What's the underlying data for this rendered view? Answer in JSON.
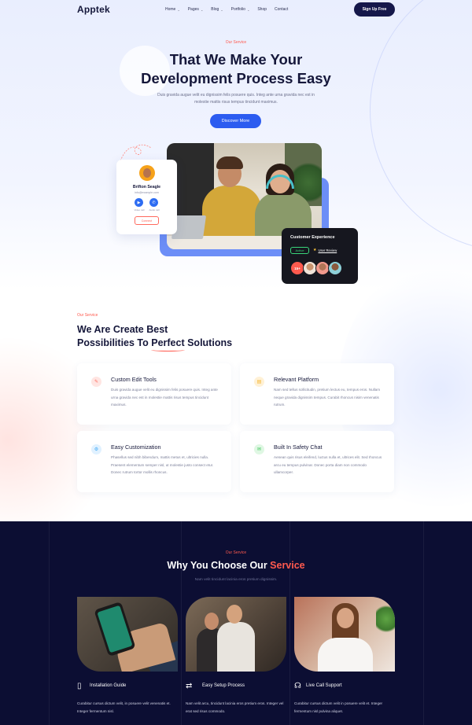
{
  "header": {
    "logo": "Apptek",
    "nav": [
      {
        "label": "Home",
        "dropdown": true
      },
      {
        "label": "Pages",
        "dropdown": true
      },
      {
        "label": "Blog",
        "dropdown": true
      },
      {
        "label": "Portfolio",
        "dropdown": true
      },
      {
        "label": "Shop",
        "dropdown": false
      },
      {
        "label": "Contact",
        "dropdown": false
      }
    ],
    "cta": "Sign Up Free"
  },
  "hero": {
    "eyebrow": "Our Service",
    "title_line1": "That We Make Your",
    "title_line2": "Development Process Easy",
    "description": "Duis gravida augue velit eu dignissim felis posuere quis. Integ ante urna gravida nec est in molestie mattis risus tempus tincidunt maximus.",
    "button": "Discover More"
  },
  "profile_card": {
    "name": "Brifton Seagle",
    "email": "info@example.com",
    "action1_label": "Video call",
    "action2_label": "Audio call",
    "connect": "Connect"
  },
  "cx_card": {
    "title": "Customer Experience",
    "status": "Active",
    "review": "User Review",
    "count": "15+"
  },
  "services": {
    "eyebrow": "Our Service",
    "title_line1": "We Are Create Best",
    "title_line2_pre": "Possibilities To ",
    "title_line2_highlight": "Perfect",
    "title_line2_post": " Solutions",
    "items": [
      {
        "name": "Custom Edit Tools",
        "icon": "edit-icon",
        "color": "#ff6a5e",
        "text": "Duis gravida augue velit eu dignissim felis posuere quis. Integ ante urna gravida nec est in molestie mattis risus tempus tincidunt maximus."
      },
      {
        "name": "Relevant Platform",
        "icon": "document-icon",
        "color": "#f5b42a",
        "text": "Nam sed tellus sollicitudin, pretium lectus eu, tempus eros. Nullam neque gravida dignissim tempus. Curabit rhoncus nisim venenatis rutrum."
      },
      {
        "name": "Easy Customization",
        "icon": "settings-icon",
        "color": "#3fa9f5",
        "text": "Phasellus sed nibh bibendum, mattis metus et, ultricies nulla. Praesent elementum semper nisl, ut molestie justo consect etur. Donec rutrum tortor mollis rhoncus."
      },
      {
        "name": "Built In Safety Chat",
        "icon": "chat-icon",
        "color": "#3ec75b",
        "text": "Aenean quis risus eleifend, luctus nulla et, ultrices elit. Sed rhoncus arcu eu tempus pulvinar. Donec porta diam non commodo ullamcorper."
      }
    ]
  },
  "why": {
    "eyebrow": "Our Service",
    "title_pre": "Why You Choose Our ",
    "title_accent": "Service",
    "description": "Nam velit tincidunt lacinia eros pretium dignissim.",
    "items": [
      {
        "name": "Installation Guide",
        "icon": "phone-icon",
        "text": "Curabitur cursus dictum velit, in posuere velit venenatis et. Integer fermentum nisl."
      },
      {
        "name": "Easy Setup Process",
        "icon": "sliders-icon",
        "text": "Nam velit arcu, tincidunt lacinia eros pretium eros. Integer vel erat sed risus commodo."
      },
      {
        "name": "Live Call Support",
        "icon": "headset-icon",
        "text": "Curabitur cursus dictum velit in posuere velit et. Integer fermentum nisl pulvina aliquet."
      }
    ]
  },
  "colors": {
    "accent": "#ff5a4e",
    "primary": "#2c5cf0",
    "navy": "#0c0e33"
  }
}
